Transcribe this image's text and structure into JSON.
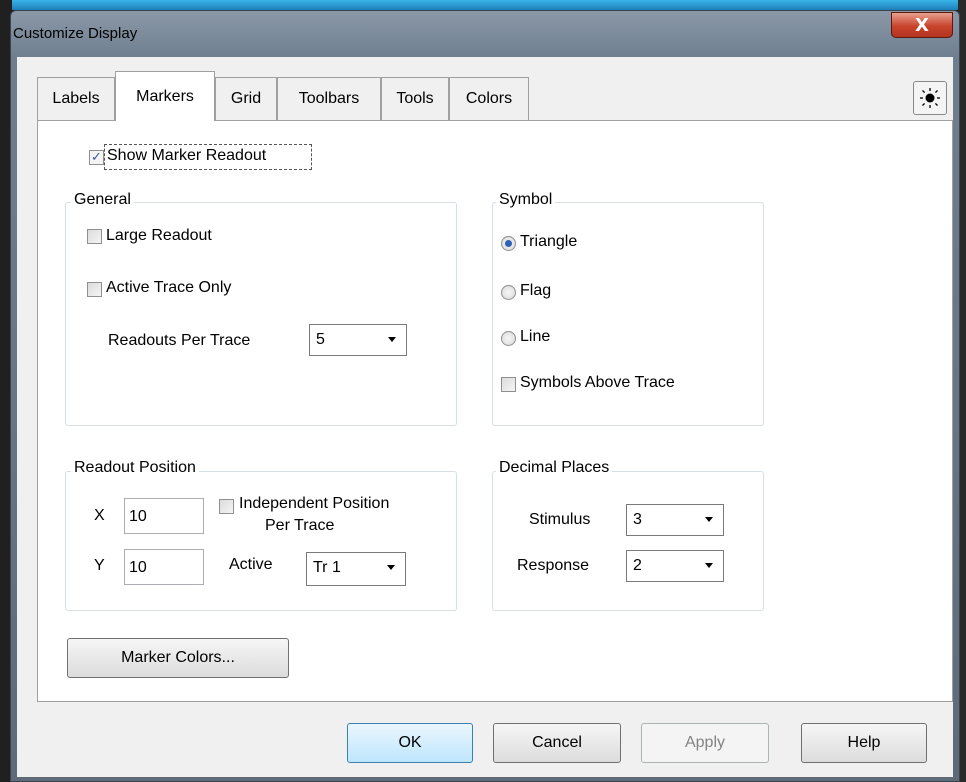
{
  "window": {
    "title": "Customize Display",
    "close_label": "X"
  },
  "tabs": [
    {
      "label": "Labels",
      "active": false
    },
    {
      "label": "Markers",
      "active": true
    },
    {
      "label": "Grid",
      "active": false
    },
    {
      "label": "Toolbars",
      "active": false
    },
    {
      "label": "Tools",
      "active": false
    },
    {
      "label": "Colors",
      "active": false
    }
  ],
  "toolbar_icon": "sun-icon",
  "show_marker_readout": {
    "label": "Show Marker Readout",
    "checked": true
  },
  "general": {
    "title": "General",
    "large_readout": {
      "label": "Large Readout",
      "checked": false
    },
    "active_trace_only": {
      "label": "Active Trace Only",
      "checked": false
    },
    "readouts_per_trace": {
      "label": "Readouts Per Trace",
      "value": "5"
    }
  },
  "symbol": {
    "title": "Symbol",
    "options": [
      {
        "label": "Triangle",
        "selected": true
      },
      {
        "label": "Flag",
        "selected": false
      },
      {
        "label": "Line",
        "selected": false
      }
    ],
    "symbols_above_trace": {
      "label": "Symbols Above Trace",
      "checked": false
    }
  },
  "readout_position": {
    "title": "Readout Position",
    "x_label": "X",
    "x_value": "10",
    "y_label": "Y",
    "y_value": "10",
    "independent_label_1": "Independent Position",
    "independent_label_2": "Per Trace",
    "independent_checked": false,
    "active_label": "Active",
    "active_value": "Tr 1"
  },
  "decimal_places": {
    "title": "Decimal Places",
    "stimulus_label": "Stimulus",
    "stimulus_value": "3",
    "response_label": "Response",
    "response_value": "2"
  },
  "marker_colors_button": "Marker Colors...",
  "footer": {
    "ok": "OK",
    "cancel": "Cancel",
    "apply": "Apply",
    "help": "Help"
  },
  "colors": {
    "title_bar": "#6f7e8e",
    "close_button": "#c8442c",
    "selection": "#2c62b6"
  }
}
